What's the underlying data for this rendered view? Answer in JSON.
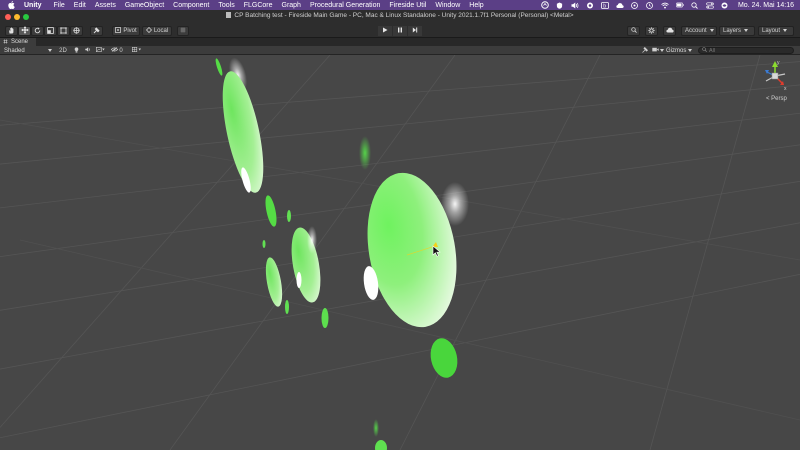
{
  "menubar": {
    "app_name": "Unity",
    "items": [
      "File",
      "Edit",
      "Assets",
      "GameObject",
      "Component",
      "Tools",
      "FLGCore",
      "Graph",
      "Procedural Generation",
      "Fireside Util",
      "Window",
      "Help"
    ],
    "clock": "Mo. 24. Mai  14:16"
  },
  "window": {
    "title": "CP Batching test - Fireside Main Game - PC, Mac & Linux Standalone - Unity 2021.1.7f1 Personal (Personal) <Metal>"
  },
  "toolbar": {
    "pivot_label": "Pivot",
    "local_label": "Local",
    "account_label": "Account",
    "layers_label": "Layers",
    "layout_label": "Layout"
  },
  "scene_tab": {
    "label": "Scene"
  },
  "scene_toolbar": {
    "shading_mode": "Shaded",
    "mode_2d_label": "2D",
    "hidden_count": "0",
    "gizmos_label": "Gizmos",
    "search_placeholder": "All"
  },
  "scene": {
    "projection_label": "< Persp",
    "gizmo_axis_y": "y",
    "gizmo_axis_x": "x",
    "colors": {
      "background": "#474747",
      "object_green": "#4fe04f",
      "object_light": "#e8f7e0",
      "menubar": "#5b3f86"
    }
  },
  "icons": [
    "apple-icon",
    "hand-tool-icon",
    "move-tool-icon",
    "rotate-tool-icon",
    "scale-tool-icon",
    "rect-tool-icon",
    "transform-tool-icon",
    "custom-tool-icon",
    "pivot-icon",
    "local-icon",
    "grid-snap-icon",
    "play-icon",
    "pause-icon",
    "step-icon",
    "search-icon",
    "gear-icon",
    "cloud-icon",
    "chevron-down-icon",
    "light-icon",
    "audio-icon",
    "effects-icon",
    "visibility-icon",
    "camera-icon",
    "tools-icon"
  ]
}
